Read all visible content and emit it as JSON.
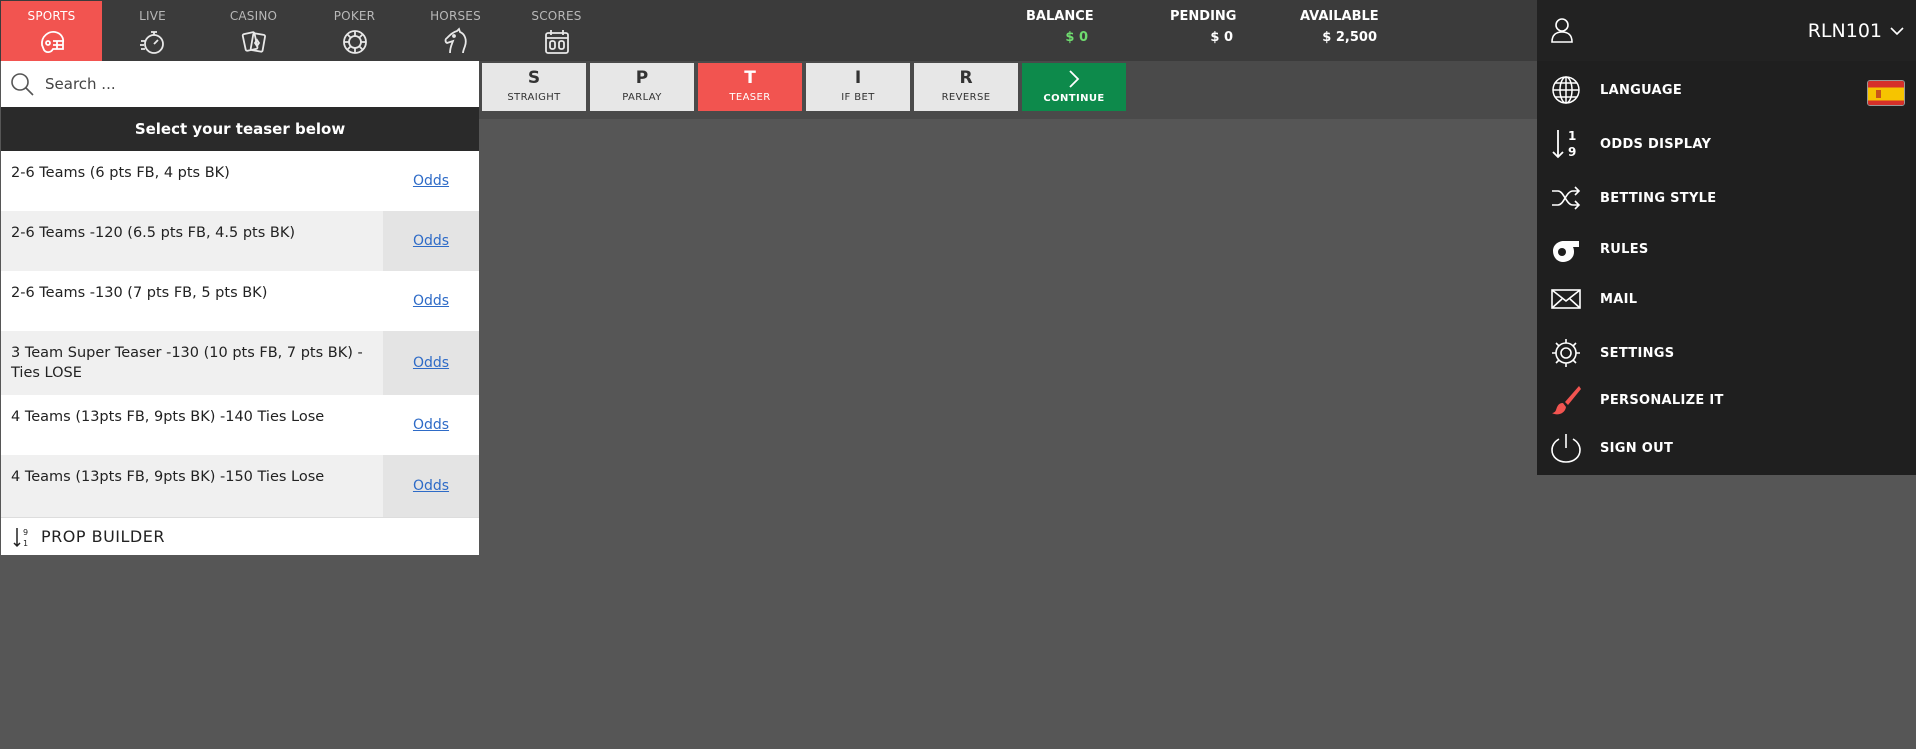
{
  "nav": {
    "items": [
      {
        "label": "SPORTS",
        "icon": "football-helmet-icon",
        "active": true
      },
      {
        "label": "LIVE",
        "icon": "stopwatch-icon",
        "active": false
      },
      {
        "label": "CASINO",
        "icon": "playing-cards-icon",
        "active": false
      },
      {
        "label": "POKER",
        "icon": "poker-chip-icon",
        "active": false
      },
      {
        "label": "HORSES",
        "icon": "horse-head-icon",
        "active": false
      },
      {
        "label": "SCORES",
        "icon": "scoreboard-calendar-icon",
        "active": false
      }
    ]
  },
  "account": {
    "balance_label": "BALANCE",
    "balance_value": "$ 0",
    "pending_label": "PENDING",
    "pending_value": "$ 0",
    "available_label": "AVAILABLE",
    "available_value": "$ 2,500"
  },
  "user": {
    "name": "RLN101",
    "avatar_icon": "user-icon",
    "menu": [
      {
        "label": "LANGUAGE",
        "icon": "globe-icon"
      },
      {
        "label": "ODDS DISPLAY",
        "icon": "odds-sort-icon"
      },
      {
        "label": "BETTING STYLE",
        "icon": "shuffle-icon"
      },
      {
        "label": "RULES",
        "icon": "whistle-icon"
      },
      {
        "label": "MAIL",
        "icon": "envelope-icon"
      },
      {
        "label": "SETTINGS",
        "icon": "gear-icon"
      },
      {
        "label": "PERSONALIZE IT",
        "icon": "paintbrush-icon"
      },
      {
        "label": "SIGN OUT",
        "icon": "power-icon"
      }
    ],
    "language_flag": "spain-flag"
  },
  "search": {
    "placeholder": "Search ..."
  },
  "teaser": {
    "header": "Select your teaser below",
    "odds_label": "Odds",
    "rows": [
      {
        "desc": "2-6 Teams (6 pts FB, 4 pts BK)"
      },
      {
        "desc": "2-6 Teams -120 (6.5 pts FB, 4.5 pts BK)"
      },
      {
        "desc": "2-6 Teams -130 (7 pts FB, 5 pts BK)"
      },
      {
        "desc": "3 Team Super Teaser -130 (10 pts FB, 7 pts BK) - Ties LOSE"
      },
      {
        "desc": "4 Teams (13pts FB, 9pts BK) -140 Ties Lose"
      },
      {
        "desc": "4 Teams (13pts FB, 9pts BK) -150 Ties Lose"
      }
    ],
    "prop_builder": "PROP BUILDER"
  },
  "bet_types": [
    {
      "letter": "S",
      "label": "STRAIGHT",
      "active": false
    },
    {
      "letter": "P",
      "label": "PARLAY",
      "active": false
    },
    {
      "letter": "T",
      "label": "TEASER",
      "active": true
    },
    {
      "letter": "I",
      "label": "IF BET",
      "active": false
    },
    {
      "letter": "R",
      "label": "REVERSE",
      "active": false
    }
  ],
  "continue_label": "CONTINUE",
  "colors": {
    "accent_red": "#f25450",
    "positive_green": "#6fdc6f",
    "continue_green": "#0d8a4b",
    "link_blue": "#2e6bc7"
  }
}
